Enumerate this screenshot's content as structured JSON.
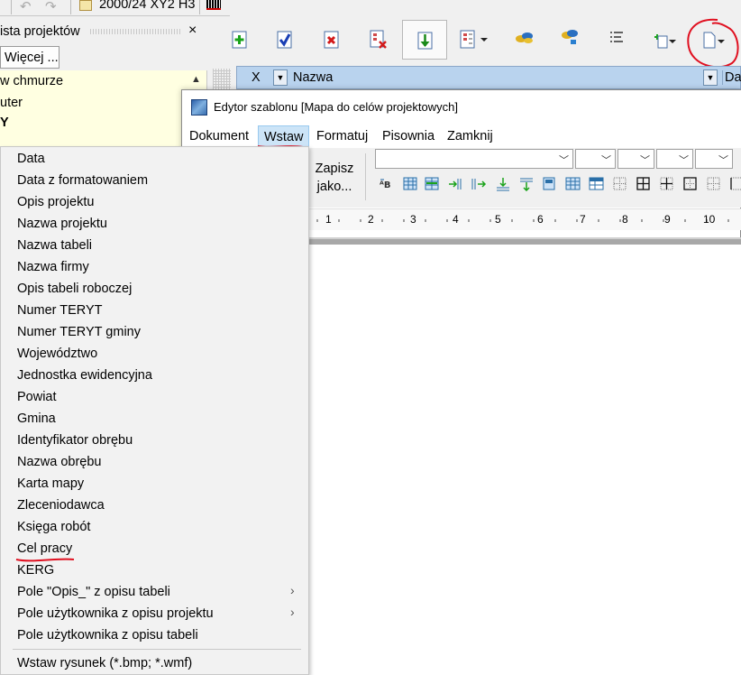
{
  "top_toolbar": {
    "coordinate_system": "2000/24 XY2 H3"
  },
  "project_panel": {
    "title": "ista projektów",
    "close_glyph": "×",
    "more_button": "Więcej ...",
    "items": [
      "w chmurze",
      "uter",
      "Y"
    ]
  },
  "grid_header": {
    "col_x": "X",
    "col_name": "Nazwa",
    "col_date": "Dat"
  },
  "editor_window": {
    "title": "Edytor szablonu [Mapa do celów projektowych]",
    "menu": [
      "Dokument",
      "Wstaw",
      "Formatuj",
      "Pisownia",
      "Zamknij"
    ],
    "save_as_line1": "Zapisz",
    "save_as_line2": "jako...",
    "ruler_marks": [
      "1",
      "2",
      "3",
      "4",
      "5",
      "6",
      "7",
      "8",
      "9",
      "10"
    ]
  },
  "insert_menu": {
    "items": [
      {
        "label": "Data"
      },
      {
        "label": "Data z formatowaniem"
      },
      {
        "label": "Opis projektu"
      },
      {
        "label": "Nazwa projektu"
      },
      {
        "label": "Nazwa tabeli"
      },
      {
        "label": "Nazwa firmy"
      },
      {
        "label": "Opis tabeli roboczej"
      },
      {
        "label": "Numer TERYT"
      },
      {
        "label": "Numer TERYT gminy"
      },
      {
        "label": "Województwo"
      },
      {
        "label": "Jednostka ewidencyjna"
      },
      {
        "label": "Powiat"
      },
      {
        "label": "Gmina"
      },
      {
        "label": "Identyfikator obrębu"
      },
      {
        "label": "Nazwa obrębu"
      },
      {
        "label": "Karta mapy"
      },
      {
        "label": "Zleceniodawca"
      },
      {
        "label": "Księga robót"
      },
      {
        "label": "Cel pracy"
      },
      {
        "label": "KERG"
      },
      {
        "label": "Pole \"Opis_\" z opisu tabeli",
        "submenu": true
      },
      {
        "label": "Pole użytkownika z opisu projektu",
        "submenu": true
      },
      {
        "label": "Pole użytkownika z opisu tabeli"
      },
      {
        "label": "Wstaw rysunek (*.bmp; *.wmf)"
      }
    ],
    "submenu_glyph": "›"
  },
  "colors": {
    "annotation_red": "#e01020",
    "header_blue": "#b9d3ee",
    "panel_yellow": "#ffffe1"
  }
}
